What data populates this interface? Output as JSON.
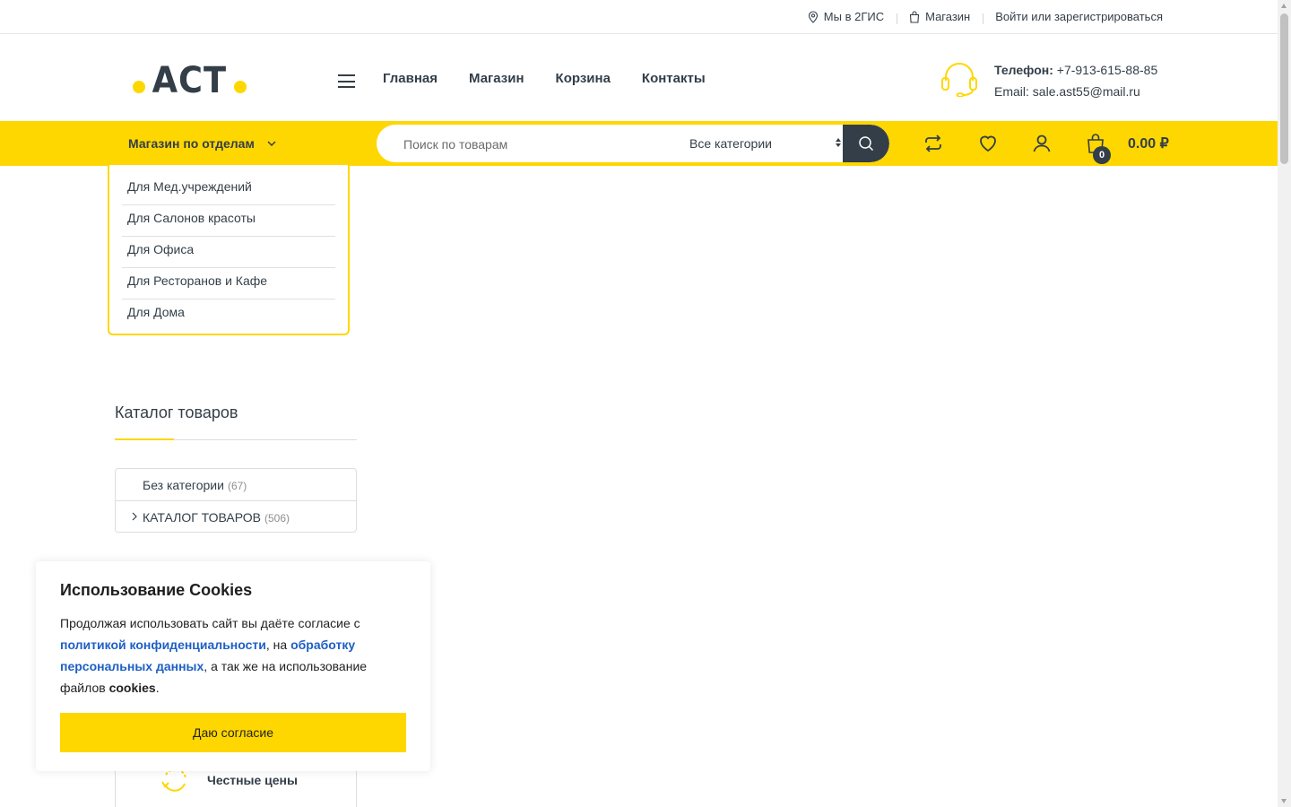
{
  "topbar": {
    "map_label": "Мы в 2ГИС",
    "shop_label": "Магазин",
    "login_label": "Войти или зарегистрироваться"
  },
  "logo": {
    "text": "АСТ"
  },
  "nav": {
    "items": [
      {
        "label": "Главная"
      },
      {
        "label": "Магазин"
      },
      {
        "label": "Корзина"
      },
      {
        "label": "Контакты"
      }
    ]
  },
  "contact": {
    "phone_label": "Телефон:",
    "phone": "+7-913-615-88-85",
    "email_label": "Email:",
    "email": "sale.ast55@mail.ru"
  },
  "shopbar": {
    "dept_label": "Магазин по отделам",
    "search_placeholder": "Поиск по товарам",
    "category_selected": "Все категории",
    "cart_count": "0",
    "cart_total": "0.00 ₽"
  },
  "departments": [
    {
      "label": "Для Мед.учреждений"
    },
    {
      "label": "Для Салонов красоты"
    },
    {
      "label": "Для Офиса"
    },
    {
      "label": "Для Ресторанов и Кафе"
    },
    {
      "label": "Для Дома"
    }
  ],
  "catalog": {
    "title": "Каталог товаров",
    "items": [
      {
        "label": "Без категории",
        "count": "(67)"
      },
      {
        "label": "КАТАЛОГ ТОВАРОВ",
        "count": "(506)"
      }
    ]
  },
  "features": {
    "fair_prices": "Честные цены"
  },
  "cookie": {
    "title": "Использование Cookies",
    "text_1": "Продолжая использовать сайт вы даёте согласие с ",
    "link_privacy": "политикой конфиденциальности",
    "text_2": ", на ",
    "link_personal": "обработку персональных данных",
    "text_3": ", а так же на использование файлов ",
    "cookies_word": "cookies",
    "text_4": ".",
    "button": "Даю согласие"
  },
  "colors": {
    "accent": "#fed700",
    "dark": "#333e48",
    "link": "#1e5fc5"
  }
}
